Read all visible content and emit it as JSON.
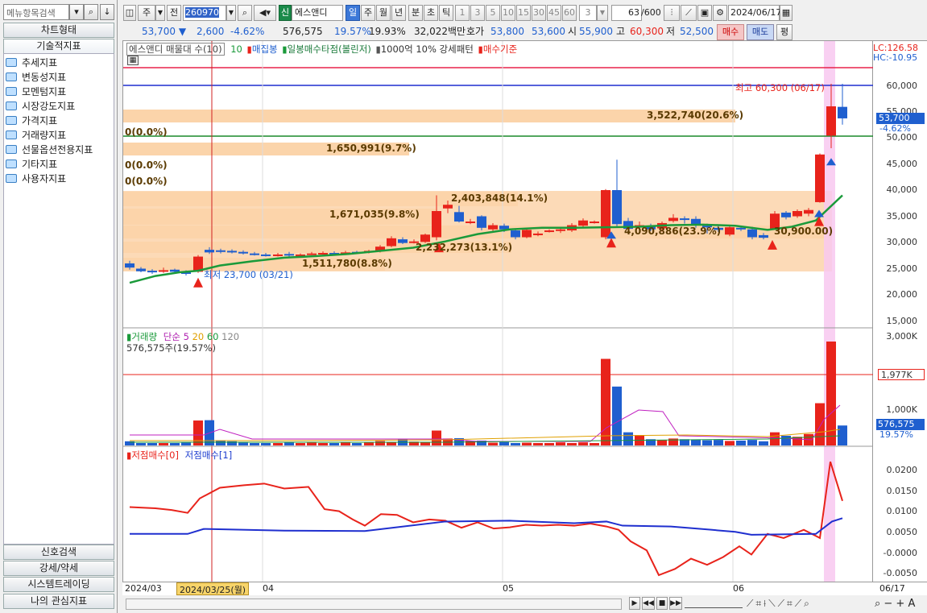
{
  "sidebar": {
    "search_placeholder": "메뉴항목검색",
    "tabs": [
      "차트형태",
      "기술적지표"
    ],
    "tree": [
      "추세지표",
      "변동성지표",
      "모멘텀지표",
      "시장강도지표",
      "가격지표",
      "거래량지표",
      "선물옵션전용지표",
      "기타지표",
      "사용자지표"
    ],
    "bottom_tabs": [
      "신호검색",
      "강세/약세",
      "시스템트레이딩",
      "나의 관심지표"
    ]
  },
  "toolbar": {
    "market": "주",
    "prev": "전",
    "code": "260970",
    "badge": "신",
    "name": "에스앤디",
    "periods": [
      "일",
      "주",
      "월",
      "년",
      "분",
      "초",
      "틱"
    ],
    "numbers": [
      "1",
      "3",
      "5",
      "10",
      "15",
      "30",
      "45",
      "60"
    ],
    "interval": "3",
    "count": "63",
    "count_total": "/600",
    "date": "2024/06/17"
  },
  "quote": {
    "price": "53,700",
    "change": "2,600",
    "change_rate": "-4.62%",
    "volume": "576,575",
    "vol_rate": "19.57%",
    "turnover": "19.93%",
    "amount": "32,022백만",
    "bid_label": "호가",
    "bid1": "53,800",
    "bid2": "53,600",
    "open_label": "시",
    "open": "55,900",
    "high_label": "고",
    "high": "60,300",
    "low_label": "저",
    "low": "52,500",
    "buy": "매수",
    "sell": "매도",
    "eval": "평"
  },
  "price_panel": {
    "legend_name": "에스앤디 매물대 수(10)",
    "legend_ma": "10",
    "legend_items": [
      "매집봉",
      "일봉매수타점(볼린저)",
      "1000억 10% 강세패턴",
      "매수기준"
    ],
    "lc": "LC:126.58",
    "hc": "HC:-10.95",
    "high_note": "최고 60,300 (06/17)",
    "low_note": "최저 23,700 (03/21)",
    "price_tag": "53,700",
    "price_tag_rate": "-4.62%",
    "y_labels": [
      "60,000",
      "55,000",
      "50,000",
      "45,000",
      "40,000",
      "35,000",
      "30,000",
      "25,000",
      "20,000",
      "15,000"
    ],
    "bands": [
      "3,522,740(20.6%)",
      "0(0.0%)",
      "1,650,991(9.7%)",
      "0(0.0%)",
      "0(0.0%)",
      "2,403,848(14.1%)",
      "1,671,035(9.8%)",
      "4,090,886(23.9%)",
      "2,232,273(13.1%)",
      "1,511,780(8.8%)",
      "30,900.00)"
    ]
  },
  "volume_panel": {
    "legend_name": "거래량",
    "legend_items": [
      "단순",
      "5",
      "20",
      "60",
      "120"
    ],
    "vol_note": "576,575주(19.57%)",
    "y_labels": [
      "3,000K",
      "1,000K"
    ],
    "tag_level": "1,977K",
    "tag_vol": "576,575",
    "tag_rate": "19.57%"
  },
  "indicator_panel": {
    "legend": [
      "저점매수[0]",
      "저점매수[1]"
    ],
    "y_labels": [
      "0.0200",
      "0.0150",
      "0.0100",
      "0.0050",
      "-0.0000",
      "-0.0050"
    ]
  },
  "xaxis": {
    "labels": [
      "2024/03",
      "04",
      "05",
      "06"
    ],
    "cursor_date": "2024/03/25(월)",
    "last_date": "06/17"
  },
  "colors": {
    "up": "#e8231b",
    "down": "#1f5fcf",
    "ma": "#1a9a3a"
  }
}
